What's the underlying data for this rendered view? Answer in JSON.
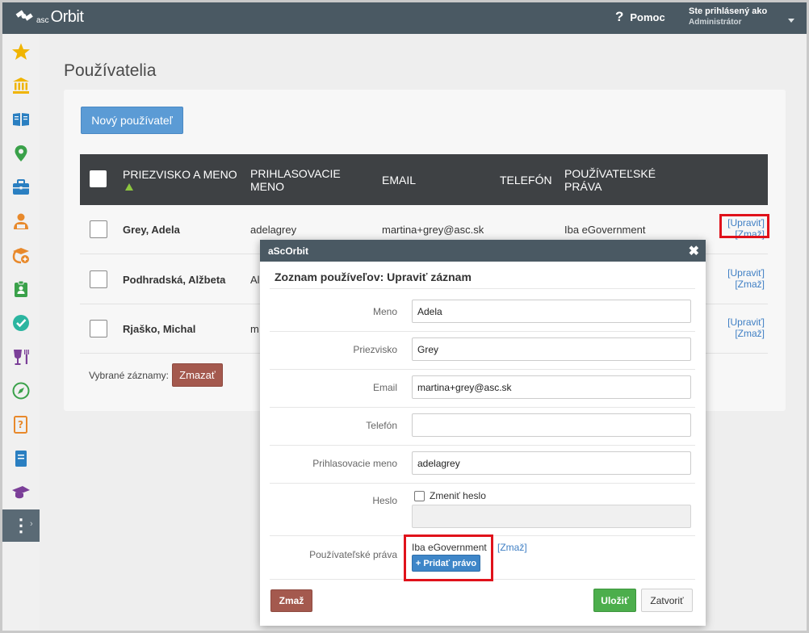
{
  "topbar": {
    "logo_brand": "Orbit",
    "logo_prefix": "asc",
    "help_label": "Pomoc",
    "user_line1": "Ste prihlásený ako",
    "user_line2": "Administrátor"
  },
  "sidebar": {
    "items": [
      {
        "icon": "star-icon",
        "color": "#f0b400"
      },
      {
        "icon": "bank-icon",
        "color": "#f0b400"
      },
      {
        "icon": "book-icon",
        "color": "#2a7fc1"
      },
      {
        "icon": "map-pin-icon",
        "color": "#3aa14a"
      },
      {
        "icon": "briefcase-icon",
        "color": "#2a7fc1"
      },
      {
        "icon": "student-icon",
        "color": "#e8892b"
      },
      {
        "icon": "graduation-settings-icon",
        "color": "#e8892b"
      },
      {
        "icon": "clipboard-person-icon",
        "color": "#3aa14a"
      },
      {
        "icon": "check-circle-icon",
        "color": "#2bb5a0"
      },
      {
        "icon": "dining-icon",
        "color": "#7b3f98"
      },
      {
        "icon": "compass-icon",
        "color": "#3aa14a"
      },
      {
        "icon": "question-book-icon",
        "color": "#e8892b"
      },
      {
        "icon": "notebook-icon",
        "color": "#2a7fc1"
      },
      {
        "icon": "graduation-cap-icon",
        "color": "#7b3f98"
      }
    ]
  },
  "page": {
    "title": "Používatelia",
    "new_user_button": "Nový používateľ"
  },
  "table": {
    "headers": {
      "name": "PRIEZVISKO A MENO",
      "login_1": "PRIHLASOVACIE",
      "login_2": "MENO",
      "email": "EMAIL",
      "phone": "TELEFÓN",
      "rights_1": "POUŽÍVATEĽSKÉ",
      "rights_2": "PRÁVA"
    },
    "rows": [
      {
        "name": "Grey, Adela",
        "login": "adelagrey",
        "email": "martina+grey@asc.sk",
        "rights": "Iba eGovernment",
        "edit": "[Upraviť]",
        "delete": "[Zmaž]"
      },
      {
        "name": "Podhradská, Alžbeta",
        "login": "Al",
        "email": "",
        "rights": "",
        "edit": "[Upraviť]",
        "delete": "[Zmaž]"
      },
      {
        "name": "Rjaško, Michal",
        "login": "m",
        "email": "",
        "rights": "",
        "edit": "[Upraviť]",
        "delete": "[Zmaž]"
      }
    ],
    "bulk_label": "Vybrané záznamy:",
    "bulk_delete": "Zmazať"
  },
  "modal": {
    "title": "aScOrbit",
    "subtitle": "Zoznam používeľov: Upraviť záznam",
    "fields": {
      "meno_label": "Meno",
      "meno_value": "Adela",
      "priezvisko_label": "Priezvisko",
      "priezvisko_value": "Grey",
      "email_label": "Email",
      "email_value": "martina+grey@asc.sk",
      "telefon_label": "Telefón",
      "telefon_value": "",
      "login_label": "Prihlasovacie meno",
      "login_value": "adelagrey",
      "heslo_label": "Heslo",
      "change_password": "Zmeniť heslo",
      "rights_label": "Používateľské práva",
      "rights_value": "Iba eGovernment",
      "rights_delete": "[Zmaž]",
      "add_right": "+ Pridať právo"
    },
    "buttons": {
      "delete": "Zmaž",
      "save": "Uložiť",
      "close": "Zatvoriť"
    }
  }
}
